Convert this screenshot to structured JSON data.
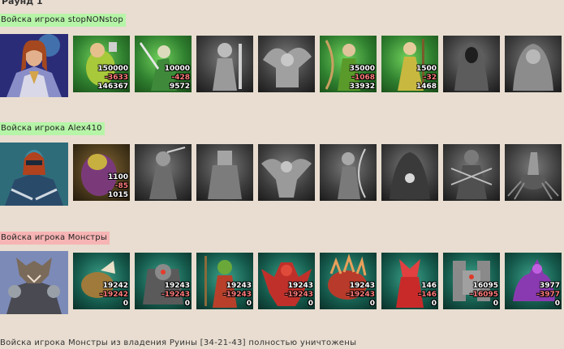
{
  "round_title": "Раунд 1",
  "footer_text": "Войска игрока Монстры из владения Руины [34-21-43] полностью уничтожены",
  "colors": {
    "background": "#e8ddd0",
    "player_label": "#b6f5a8",
    "enemy_label": "#f7b4b4",
    "loss_number": "#ff7b7b"
  },
  "armies": [
    {
      "label": "Войска игрока stopNONstop",
      "units": [
        {
          "icon": "gnome-warrior",
          "count": "150000",
          "loss": "-3633",
          "remaining": "146367"
        },
        {
          "icon": "elf-swordsman",
          "count": "10000",
          "loss": "-428",
          "remaining": "9572"
        },
        {
          "icon": "knight-silhouette",
          "count": "",
          "loss": "",
          "remaining": ""
        },
        {
          "icon": "griffin-silhouette",
          "count": "",
          "loss": "",
          "remaining": ""
        },
        {
          "icon": "elf-archer",
          "count": "35000",
          "loss": "-1068",
          "remaining": "33932"
        },
        {
          "icon": "druid",
          "count": "1500",
          "loss": "-32",
          "remaining": "1468"
        },
        {
          "icon": "hooded-mage-silhouette",
          "count": "",
          "loss": "",
          "remaining": ""
        },
        {
          "icon": "ghost-silhouette",
          "count": "",
          "loss": "",
          "remaining": ""
        }
      ]
    },
    {
      "label": "Войска игрока Alex410",
      "units": [
        {
          "icon": "troll-brute",
          "count": "1100",
          "loss": "-85",
          "remaining": "1015"
        },
        {
          "icon": "assassin-silhouette",
          "count": "",
          "loss": "",
          "remaining": ""
        },
        {
          "icon": "armored-warrior-silhouette",
          "count": "",
          "loss": "",
          "remaining": ""
        },
        {
          "icon": "harpy-silhouette",
          "count": "",
          "loss": "",
          "remaining": ""
        },
        {
          "icon": "dark-archer-silhouette",
          "count": "",
          "loss": "",
          "remaining": ""
        },
        {
          "icon": "warlock-silhouette",
          "count": "",
          "loss": "",
          "remaining": ""
        },
        {
          "icon": "blade-dancer-silhouette",
          "count": "",
          "loss": "",
          "remaining": ""
        },
        {
          "icon": "spider-rider-silhouette",
          "count": "",
          "loss": "",
          "remaining": ""
        }
      ]
    },
    {
      "label": "Войска игрока Монстры",
      "units": [
        {
          "icon": "lizard-beast",
          "count": "19242",
          "loss": "-19242",
          "remaining": "0"
        },
        {
          "icon": "armored-ogre",
          "count": "19243",
          "loss": "-19243",
          "remaining": "0"
        },
        {
          "icon": "orc-shaman",
          "count": "19243",
          "loss": "-19243",
          "remaining": "0"
        },
        {
          "icon": "red-demon",
          "count": "19243",
          "loss": "-19243",
          "remaining": "0"
        },
        {
          "icon": "fire-beast",
          "count": "19243",
          "loss": "-19243",
          "remaining": "0"
        },
        {
          "icon": "fire-imp",
          "count": "146",
          "loss": "-146",
          "remaining": "0"
        },
        {
          "icon": "stone-golem",
          "count": "16095",
          "loss": "-16095",
          "remaining": "0"
        },
        {
          "icon": "purple-dragon",
          "count": "3977",
          "loss": "-3977",
          "remaining": "0"
        }
      ]
    }
  ]
}
